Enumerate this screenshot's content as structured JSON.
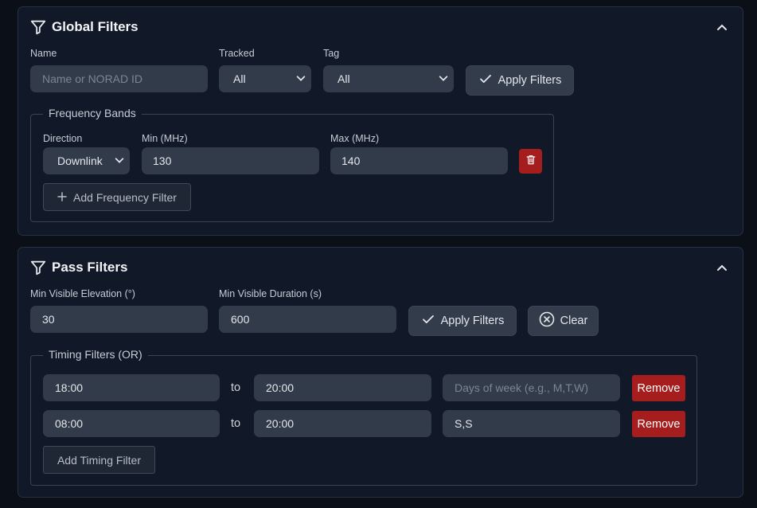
{
  "global_filters": {
    "title": "Global Filters",
    "name_label": "Name",
    "name_placeholder": "Name or NORAD ID",
    "tracked_label": "Tracked",
    "tracked_value": "All",
    "tag_label": "Tag",
    "tag_value": "All",
    "apply_label": "Apply Filters",
    "frequency_bands": {
      "legend": "Frequency Bands",
      "direction_label": "Direction",
      "direction_value": "Downlink",
      "min_label": "Min (MHz)",
      "min_value": "130",
      "max_label": "Max (MHz)",
      "max_value": "140",
      "add_label": "Add Frequency Filter"
    }
  },
  "pass_filters": {
    "title": "Pass Filters",
    "min_elevation_label": "Min Visible Elevation (°)",
    "min_elevation_value": "30",
    "min_duration_label": "Min Visible Duration (s)",
    "min_duration_value": "600",
    "apply_label": "Apply Filters",
    "clear_label": "Clear",
    "timing": {
      "legend": "Timing Filters (OR)",
      "to_label": "to",
      "days_placeholder": "Days of week (e.g., M,T,W)",
      "remove_label": "Remove",
      "rows": [
        {
          "start": "18:00",
          "end": "20:00",
          "days": ""
        },
        {
          "start": "08:00",
          "end": "20:00",
          "days": "S,S"
        }
      ],
      "add_label": "Add Timing Filter"
    }
  },
  "colors": {
    "background": "#0b1018",
    "panel": "#111827",
    "input": "#323b4a",
    "danger": "#a51d1d"
  }
}
